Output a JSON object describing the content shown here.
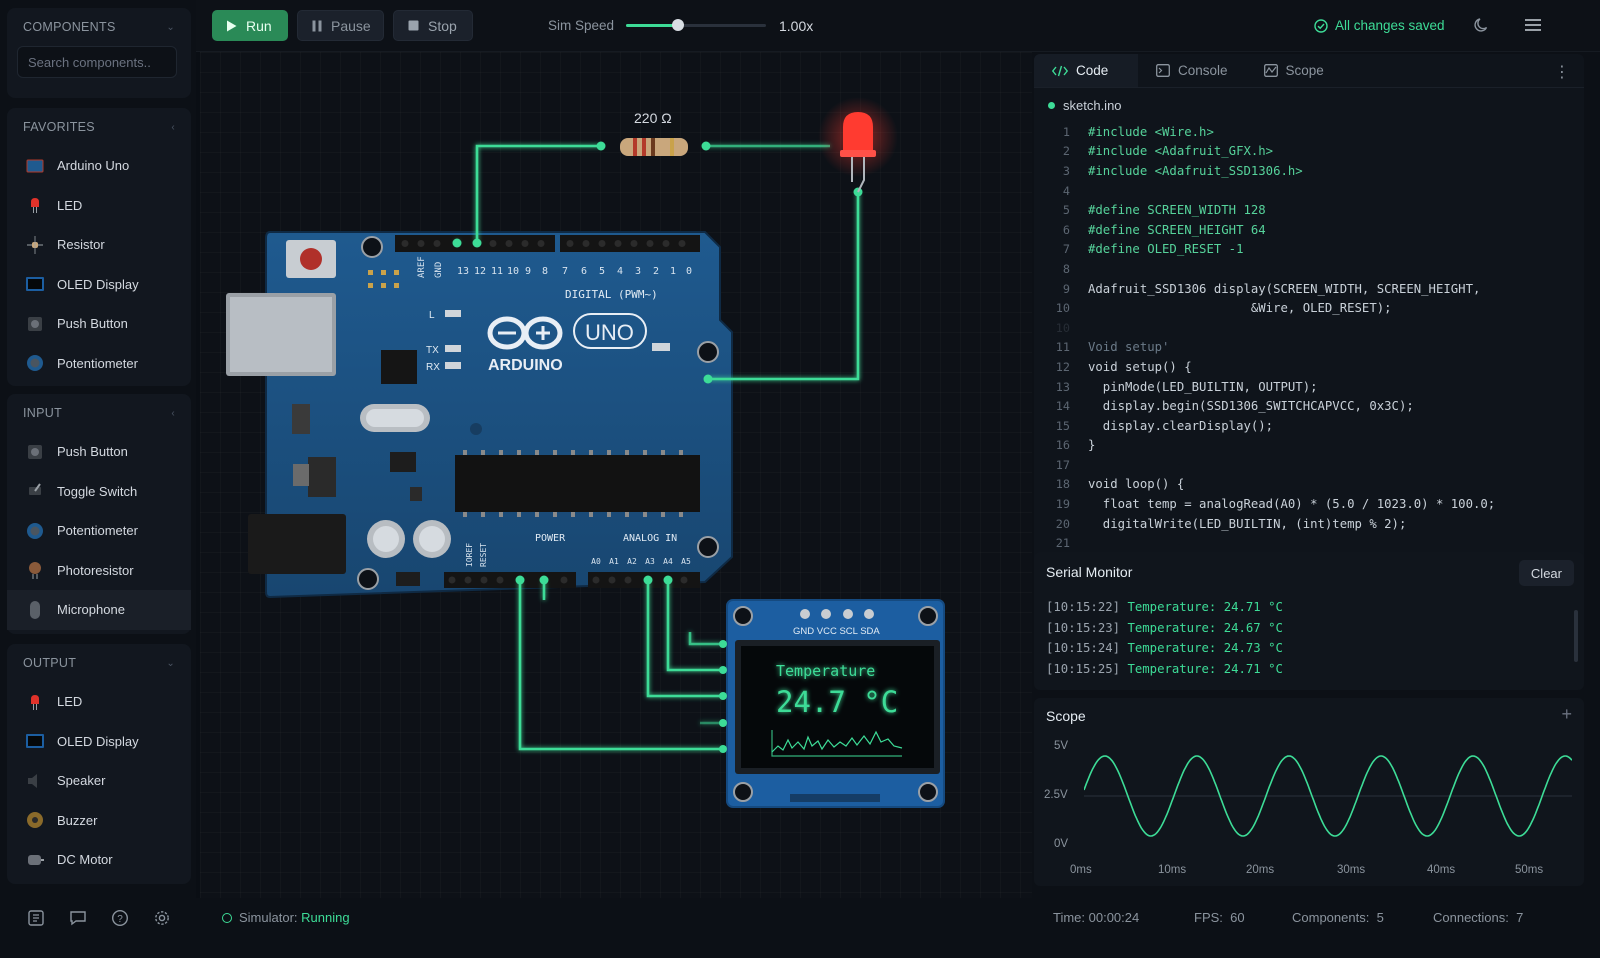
{
  "sidebar": {
    "components_title": "COMPONENTS",
    "search_placeholder": "Search components..",
    "favorites": {
      "title": "FAVORITES",
      "items": [
        {
          "label": "Arduino Uno",
          "icon": "arduino-uno-icon"
        },
        {
          "label": "LED",
          "icon": "led-icon"
        },
        {
          "label": "Resistor",
          "icon": "resistor-icon"
        },
        {
          "label": "OLED Display",
          "icon": "oled-display-icon"
        },
        {
          "label": "Push Button",
          "icon": "push-button-icon"
        },
        {
          "label": "Potentiometer",
          "icon": "potentiometer-icon"
        }
      ]
    },
    "input": {
      "title": "INPUT",
      "items": [
        {
          "label": "Push Button",
          "icon": "push-button-icon"
        },
        {
          "label": "Toggle Switch",
          "icon": "toggle-switch-icon"
        },
        {
          "label": "Potentiometer",
          "icon": "potentiometer-icon"
        },
        {
          "label": "Photoresistor",
          "icon": "photoresistor-icon"
        },
        {
          "label": "Microphone",
          "icon": "microphone-icon"
        }
      ]
    },
    "output": {
      "title": "OUTPUT",
      "items": [
        {
          "label": "LED",
          "icon": "led-icon"
        },
        {
          "label": "OLED Display",
          "icon": "oled-display-icon"
        },
        {
          "label": "Speaker",
          "icon": "speaker-icon"
        },
        {
          "label": "Buzzer",
          "icon": "buzzer-icon"
        },
        {
          "label": "DC Motor",
          "icon": "dc-motor-icon"
        }
      ]
    }
  },
  "toolbar": {
    "run_label": "Run",
    "pause_label": "Pause",
    "stop_label": "Stop",
    "sim_speed_label": "Sim Speed",
    "sim_speed_value": "1.00x",
    "sim_speed_fraction": 0.37,
    "saved_label": "All changes saved"
  },
  "circuit": {
    "resistor_label": "220 Ω",
    "board_brand": "ARDUINO",
    "board_model": "UNO",
    "digital_label": "DIGITAL (PWM~)",
    "power_label": "POWER",
    "analog_label": "ANALOG IN",
    "tx_label": "TX",
    "rx_label": "RX",
    "l_label": "L",
    "pin13_label": "13",
    "digital_pins": [
      "12",
      "11",
      "10",
      "9",
      "8",
      "7",
      "6",
      "5",
      "4",
      "3",
      "2",
      "1",
      "0"
    ],
    "analog_pins": [
      "A0",
      "A1",
      "A2",
      "A3",
      "A4",
      "A5"
    ],
    "oled_pins": "GND VCC SCL SDA",
    "oled_title": "Temperature",
    "oled_value": "24.7 °C"
  },
  "editor": {
    "tabs": [
      {
        "label": "Code",
        "icon": "code-icon"
      },
      {
        "label": "Console",
        "icon": "console-icon"
      },
      {
        "label": "Scope",
        "icon": "scope-icon"
      }
    ],
    "filename": "sketch.ino",
    "lines": [
      {
        "n": "1",
        "t": "#include <Wire.h>"
      },
      {
        "n": "2",
        "t": "#include <Adafruit_GFX.h>"
      },
      {
        "n": "3",
        "t": "#include <Adafruit_SSD1306.h>"
      },
      {
        "n": "4",
        "t": ""
      },
      {
        "n": "5",
        "t": "#define SCREEN_WIDTH 128"
      },
      {
        "n": "6",
        "t": "#define SCREEN_HEIGHT 64"
      },
      {
        "n": "7",
        "t": "#define OLED_RESET -1"
      },
      {
        "n": "8",
        "t": ""
      },
      {
        "n": "9",
        "t": "Adafruit_SSD1306 display(SCREEN_WIDTH, SCREEN_HEIGHT,"
      },
      {
        "n": "10",
        "t": "                      &Wire, OLED_RESET);"
      },
      {
        "n": "10",
        "t": ""
      },
      {
        "n": "11",
        "t": "Void setup'"
      },
      {
        "n": "12",
        "t": "void setup() {"
      },
      {
        "n": "13",
        "t": "  pinMode(LED_BUILTIN, OUTPUT);"
      },
      {
        "n": "14",
        "t": "  display.begin(SSD1306_SWITCHCAPVCC, 0x3C);"
      },
      {
        "n": "15",
        "t": "  display.clearDisplay();"
      },
      {
        "n": "16",
        "t": "}"
      },
      {
        "n": "17",
        "t": ""
      },
      {
        "n": "18",
        "t": "void loop() {"
      },
      {
        "n": "19",
        "t": "  float temp = analogRead(A0) * (5.0 / 1023.0) * 100.0;"
      },
      {
        "n": "20",
        "t": "  digitalWrite(LED_BUILTIN, (int)temp % 2);"
      },
      {
        "n": "21",
        "t": ""
      }
    ]
  },
  "serial": {
    "title": "Serial Monitor",
    "clear_label": "Clear",
    "lines": [
      {
        "ts": "[10:15:22]",
        "msg": "Temperature: 24.71 °C"
      },
      {
        "ts": "[10:15:23]",
        "msg": "Temperature: 24.67 °C"
      },
      {
        "ts": "[10:15:24]",
        "msg": "Temperature: 24.73 °C"
      },
      {
        "ts": "[10:15:25]",
        "msg": "Temperature: 24.71 °C"
      }
    ]
  },
  "scope": {
    "title": "Scope",
    "y_labels": [
      "5V",
      "2.5V",
      "0V"
    ],
    "x_labels": [
      "0ms",
      "10ms",
      "20ms",
      "30ms",
      "40ms",
      "50ms"
    ],
    "cycles": 5.3,
    "color": "#3ddc97"
  },
  "status": {
    "simulator_label": "Simulator:",
    "simulator_state": "Running",
    "time": "Time: 00:00:24",
    "fps_label": "FPS:",
    "fps": "60",
    "components_label": "Components:",
    "components": "5",
    "connections_label": "Connections:",
    "connections": "7"
  },
  "colors": {
    "accent": "#3ddc97",
    "run_button": "#2a8a57",
    "board": "#1c4f7f",
    "led": "#ff3b30"
  }
}
